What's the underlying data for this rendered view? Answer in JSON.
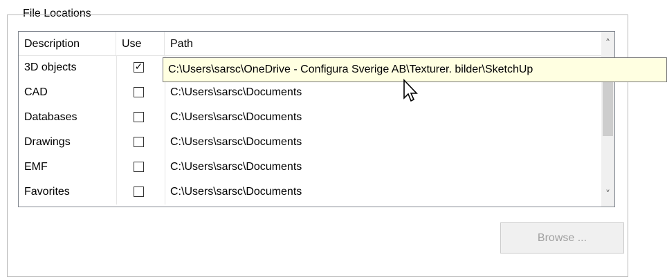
{
  "group": {
    "title": "File Locations"
  },
  "list": {
    "columns": {
      "description": "Description",
      "use": "Use",
      "path": "Path"
    },
    "rows": [
      {
        "description": "3D objects",
        "use": true,
        "use_mark": "✓",
        "path": ""
      },
      {
        "description": "CAD",
        "use": false,
        "use_mark": "",
        "path": "C:\\Users\\sarsc\\Documents"
      },
      {
        "description": "Databases",
        "use": false,
        "use_mark": "",
        "path": "C:\\Users\\sarsc\\Documents"
      },
      {
        "description": "Drawings",
        "use": false,
        "use_mark": "",
        "path": "C:\\Users\\sarsc\\Documents"
      },
      {
        "description": "EMF",
        "use": false,
        "use_mark": "",
        "path": "C:\\Users\\sarsc\\Documents"
      },
      {
        "description": "Favorites",
        "use": false,
        "use_mark": "",
        "path": "C:\\Users\\sarsc\\Documents"
      }
    ]
  },
  "scrollbar": {
    "up_icon": "chevron-up-icon",
    "down_icon": "chevron-down-icon",
    "up_glyph": "˄",
    "down_glyph": "˅"
  },
  "tooltip": {
    "text": "C:\\Users\\sarsc\\OneDrive - Configura Sverige AB\\Texturer. bilder\\SketchUp"
  },
  "buttons": {
    "browse_label": "Browse ..."
  },
  "colors": {
    "tooltip_bg": "#ffffe1",
    "disabled_text": "#a0a0a0"
  }
}
